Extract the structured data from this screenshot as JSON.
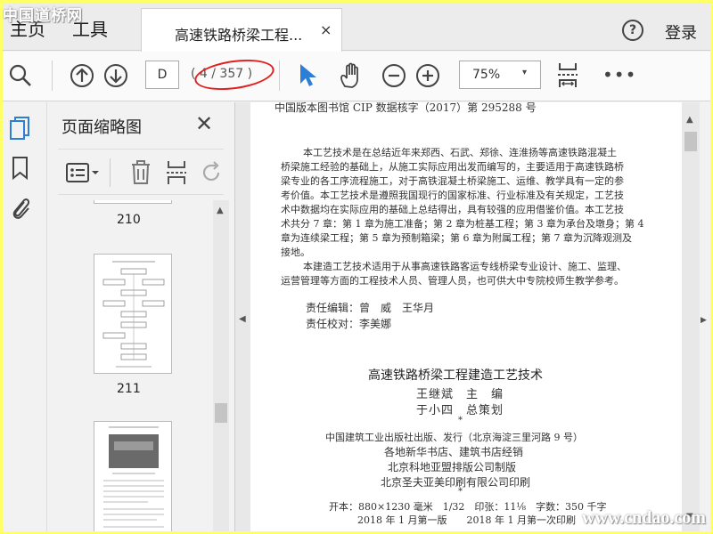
{
  "watermark_top": "中国道桥网",
  "watermark_bottom": "www.cndao.com",
  "menu": {
    "home": "主页",
    "tools": "工具"
  },
  "tab": {
    "title": "高速铁路桥梁工程...",
    "close": "×"
  },
  "header": {
    "help": "?",
    "login": "登录"
  },
  "toolbar": {
    "page_input": "D",
    "page_count": "( 4 / 357 )",
    "zoom": "75%",
    "zoom_arrow": "▾",
    "more": "•••"
  },
  "panel": {
    "title": "页面缩略图",
    "close": "✕"
  },
  "thumbnails": [
    {
      "label": "210"
    },
    {
      "label": "211"
    }
  ],
  "document": {
    "cip": "中国版本图书馆 CIP 数据核字（2017）第 295288 号",
    "para1": [
      "本工艺技术是在总结近年来郑西、石武、郑徐、连淮扬等高速铁路混凝土",
      "桥梁施工经验的基础上，从施工实际应用出发而编写的，主要适用于高速铁路桥",
      "梁专业的各工序流程施工，对于高铁混凝土桥梁施工、运维、教学具有一定的参",
      "考价值。本工艺技术是遵照我国现行的国家标准、行业标准及有关规定，工艺技",
      "术中数据均在实际应用的基础上总结得出，具有较强的应用借鉴价值。本工艺技",
      "术共分 7 章：第 1 章为施工准备；第 2 章为桩基工程；第 3 章为承台及墩身；第 4",
      "章为连续梁工程；第 5 章为预制箱梁；第 6 章为附属工程；第 7 章为沉降观测及",
      "接地。"
    ],
    "para2": [
      "本建造工艺技术适用于从事高速铁路客运专线桥梁专业设计、施工、监理、",
      "运营管理等方面的工程技术人员、管理人员，也可供大中专院校师生教学参考。"
    ],
    "editor": "责任编辑：曾　威　王华月",
    "proofreader": "责任校对：李美娜",
    "book_title": "高速铁路桥梁工程建造工艺技术",
    "author1": "王继斌　主　编",
    "author2": "于小四　总策划",
    "star": "*",
    "publisher": "中国建筑工业出版社出版、发行（北京海淀三里河路 9 号）",
    "dist": "各地新华书店、建筑书店经销",
    "typeset": "北京科地亚盟排版公司制版",
    "printer": "北京圣夫亚美印刷有限公司印刷",
    "specs": "开本：880×1230 毫米　1/32　印张：11⅛　字数：350 千字",
    "edition": "2018 年 1 月第一版　　2018 年 1 月第一次印刷"
  }
}
